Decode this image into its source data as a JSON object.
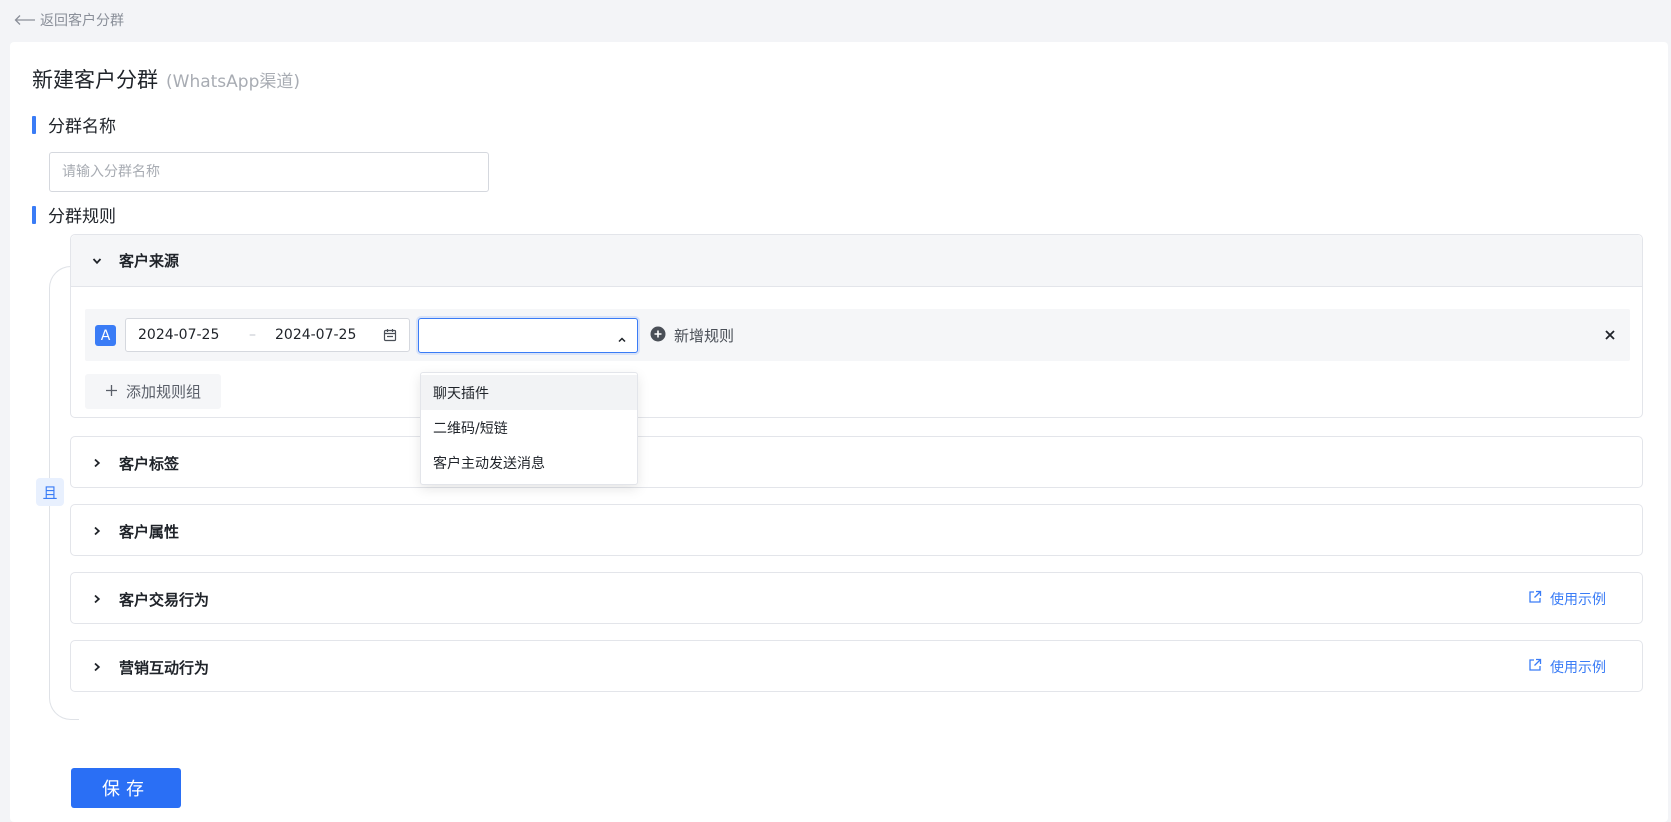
{
  "nav": {
    "back_label": "返回客户分群"
  },
  "page": {
    "title": "新建客户分群",
    "subtitle": "(WhatsApp渠道)"
  },
  "name_section": {
    "title": "分群名称",
    "placeholder": "请输入分群名称",
    "value": ""
  },
  "rules_section": {
    "title": "分群规则",
    "logic_label": "且"
  },
  "panels": [
    {
      "title": "客户来源",
      "expanded": true
    },
    {
      "title": "客户标签",
      "expanded": false
    },
    {
      "title": "客户属性",
      "expanded": false
    },
    {
      "title": "客户交易行为",
      "expanded": false,
      "link": "使用示例"
    },
    {
      "title": "营销互动行为",
      "expanded": false,
      "link": "使用示例"
    }
  ],
  "rule_group": {
    "tag": "A",
    "date_start": "2024-07-25",
    "date_separator": "–",
    "date_end": "2024-07-25",
    "source_value": "",
    "add_rule_label": "新增规则",
    "add_group_label": "添加规则组"
  },
  "source_options": [
    "聊天插件",
    "二维码/短链",
    "客户主动发送消息"
  ],
  "save_label": "保存",
  "colors": {
    "accent": "#3a7cf6",
    "primary_button": "#2a6ff5",
    "background": "#f3f4f7"
  },
  "icons": [
    "back-arrow-icon",
    "chevron-down-icon",
    "chevron-right-icon",
    "calendar-icon",
    "chevron-up-icon",
    "plus-circle-icon",
    "close-icon",
    "plus-icon",
    "external-link-icon"
  ]
}
